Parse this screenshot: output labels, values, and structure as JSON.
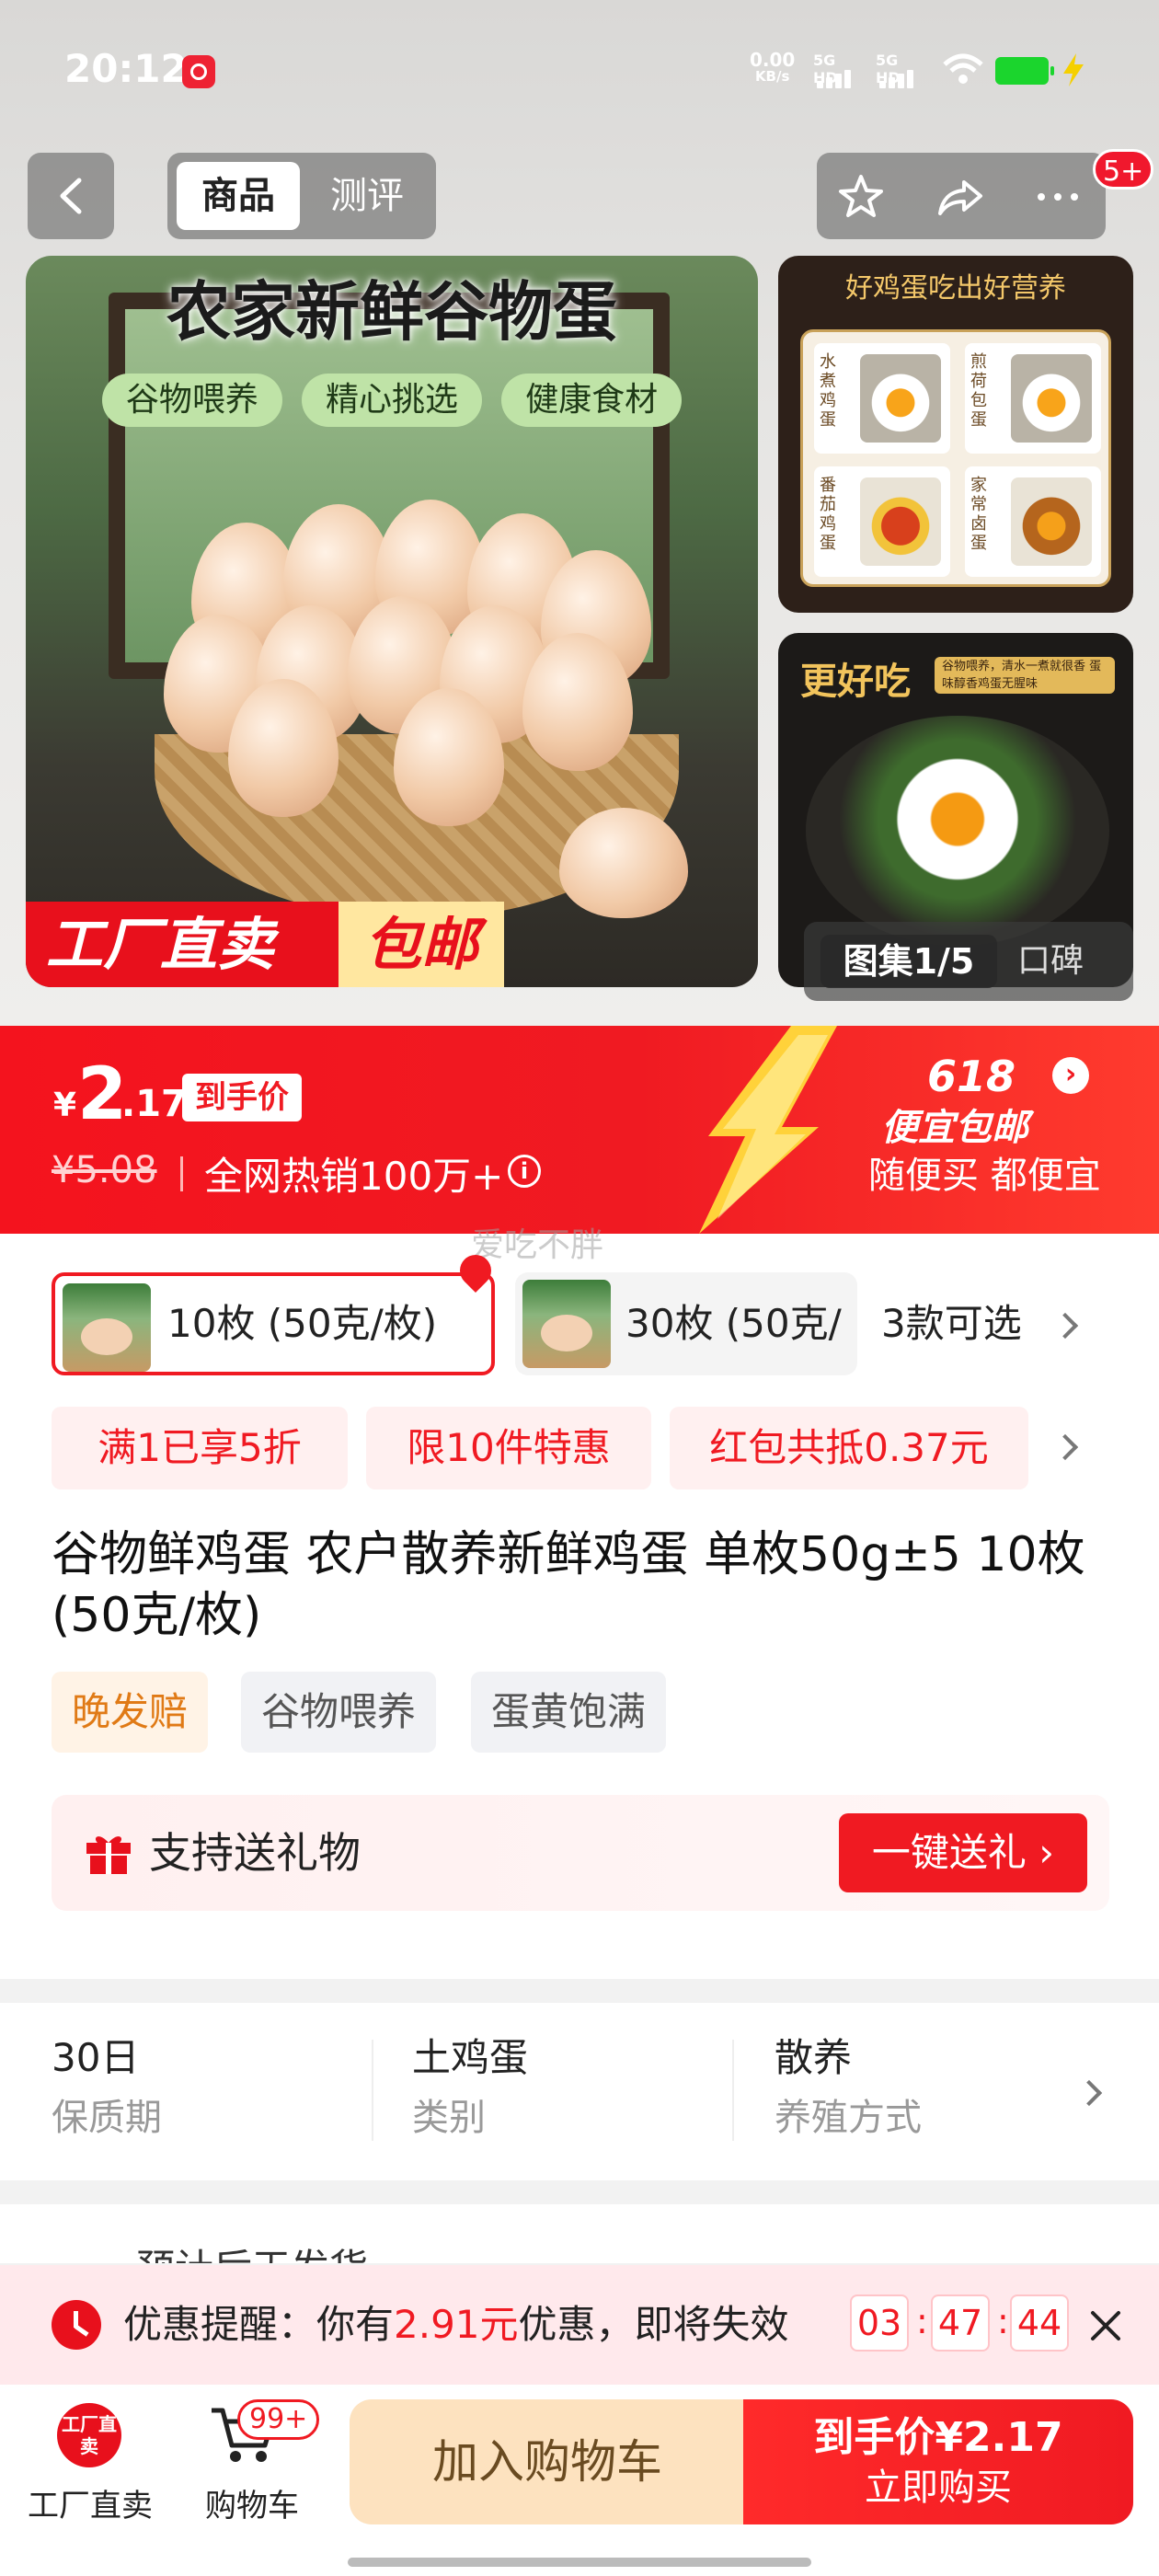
{
  "status_bar": {
    "time": "20:12",
    "net_speed_value": "0.00",
    "net_speed_unit": "KB/s",
    "sim1": "5G HD",
    "sim2": "5G HD"
  },
  "header": {
    "tabs": [
      "商品",
      "测评"
    ],
    "active_tab": "商品",
    "message_badge": "5+"
  },
  "gallery": {
    "main_title": "农家新鲜谷物蛋",
    "main_chips": [
      "谷物喂养",
      "精心挑选",
      "健康食材"
    ],
    "main_strip": [
      "工厂直卖",
      "包邮"
    ],
    "side1_caption": "好鸡蛋吃出好营养",
    "side1_dishes": [
      "水煮鸡蛋",
      "煎荷包蛋",
      "番茄鸡蛋",
      "家常卤蛋"
    ],
    "side2_title": "更好吃",
    "side2_tag": "谷物喂养，清水一煮就很香 蛋味醇香鸡蛋无腥味",
    "counter_label": "图集1/5",
    "reviews_label": "口碑"
  },
  "price": {
    "currency": "¥",
    "integer": "2",
    "decimal": ".17",
    "final_tag": "到手价",
    "original": "¥5.08",
    "sales": "全网热销100万+",
    "campaign": "618",
    "campaign_sub": "便宜包邮",
    "slogan": "随便买 都便宜",
    "info_icon": "i"
  },
  "watermark": "爱吃不胖",
  "skus": {
    "selected": "10枚 (50克/枚)",
    "other": "30枚 (50克/",
    "more": "3款可选"
  },
  "promos": [
    "满1已享5折",
    "限10件特惠",
    "红包共抵0.37元"
  ],
  "product": {
    "title": "谷物鲜鸡蛋 农户散养新鲜鸡蛋 单枚50g±5 10枚 (50克/枚)",
    "tags": [
      "晚发赔",
      "谷物喂养",
      "蛋黄饱满"
    ]
  },
  "gift": {
    "label": "支持送礼物",
    "button": "一键送礼 ›"
  },
  "specs": [
    {
      "value": "30日",
      "key": "保质期"
    },
    {
      "value": "土鸡蛋",
      "key": "类别"
    },
    {
      "value": "散养",
      "key": "养殖方式"
    }
  ],
  "shipping_partial": "预计后天发货",
  "reminder": {
    "prefix": "优惠提醒：你有",
    "amount": "2.91元",
    "suffix": "优惠，即将失效",
    "hh": "03",
    "mm": "47",
    "ss": "44"
  },
  "bottom": {
    "factory_icon_text": "工厂直卖",
    "factory_label": "工厂直卖",
    "cart_badge": "99+",
    "cart_label": "购物车",
    "add_cart": "加入购物车",
    "buy_line1": "到手价¥2.17",
    "buy_line2": "立即购买"
  },
  "colors": {
    "brand_red": "#f01a22",
    "price_banner": "#f4131e",
    "add_cart_bg": "#fde2bf"
  }
}
